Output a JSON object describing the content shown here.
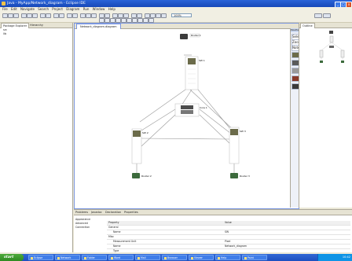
{
  "window": {
    "title": "Java - MyApp/Network_diagram - Eclipse IDE",
    "min_label": "_",
    "max_label": "□",
    "close_label": "x"
  },
  "menu": [
    "File",
    "Edit",
    "Navigate",
    "Search",
    "Project",
    "Diagram",
    "Run",
    "Window",
    "Help"
  ],
  "toolbar": {
    "zoom_value": "100%"
  },
  "left_panel": {
    "tabs": [
      "Package Explorer",
      "Hierarchy"
    ],
    "tree": [
      "src",
      "lib"
    ]
  },
  "editor": {
    "tab_title": "Network_diagram.diagram"
  },
  "palette": {
    "header": "Palette",
    "items": [
      "Select",
      "Zoom",
      "Note",
      "Router",
      "Switch",
      "Server",
      "Firewall",
      "Connection"
    ]
  },
  "diagram": {
    "nodes": {
      "router_top": "Router 1",
      "switch_top": "SW 1",
      "center_device": "Core 1",
      "switch_left": "SW 2",
      "switch_right": "SW 3",
      "router_left": "Router 2",
      "router_right": "Router 3"
    }
  },
  "right_panel": {
    "tab": "Outline"
  },
  "bottom_panel": {
    "tabs": [
      "Problems",
      "Javadoc",
      "Declaration",
      "Properties"
    ],
    "side_items": [
      "Appearance",
      "Advanced",
      "Connection"
    ],
    "header": [
      "Property",
      "Value"
    ],
    "rows": [
      {
        "prop": "General",
        "val": ""
      },
      {
        "prop": "Name",
        "val": "SW"
      },
      {
        "prop": "Misc",
        "val": ""
      },
      {
        "prop": "Measurement Unit",
        "val": "Pixel"
      },
      {
        "prop": "Name",
        "val": "Network_diagram"
      },
      {
        "prop": "Type",
        "val": ""
      }
    ]
  },
  "taskbar": {
    "start": "start",
    "buttons": [
      "Eclipse",
      "Network",
      "Folder",
      "Word",
      "Mail",
      "Browser",
      "Viewer",
      "Help",
      "Paint"
    ],
    "clock": "10:42"
  },
  "colors": {
    "taskbar": "#1d4fbf",
    "titlebar": "#2a64d8",
    "editor_border": "#7a96df"
  }
}
